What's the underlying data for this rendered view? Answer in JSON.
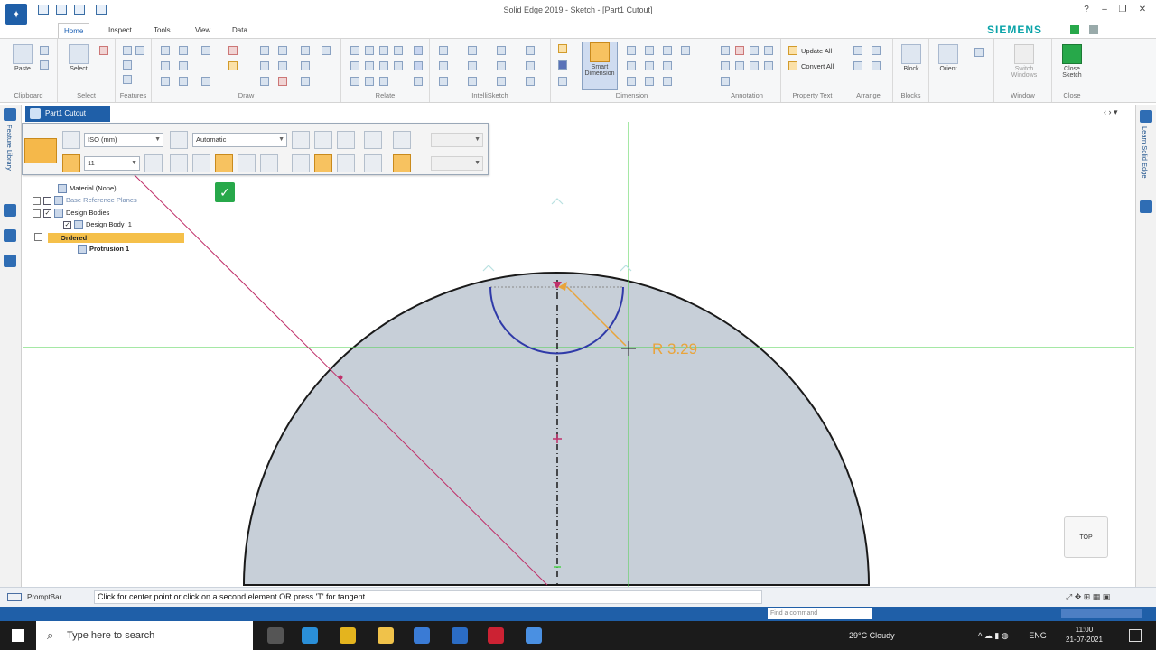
{
  "window": {
    "title": "Solid Edge 2019 - Sketch - [Part1 Cutout]",
    "brand": "SIEMENS"
  },
  "ribbon": {
    "tabs": [
      "Home",
      "Inspect",
      "Tools",
      "View",
      "Data Management"
    ],
    "active_tab": "Home",
    "groups": {
      "clipboard": {
        "label": "Clipboard",
        "paste": "Paste"
      },
      "select": {
        "label": "Select",
        "select": "Select"
      },
      "features": {
        "label": "Features"
      },
      "draw": {
        "label": "Draw"
      },
      "relate": {
        "label": "Relate"
      },
      "intellisketch": {
        "label": "IntelliSketch"
      },
      "dimension": {
        "label": "Dimension",
        "smart_dimension": "Smart Dimension"
      },
      "annotation": {
        "label": "Annotation"
      },
      "property_text": {
        "label": "Property Text",
        "update_all": "Update All",
        "convert_all": "Convert All"
      },
      "arrange": {
        "label": "Arrange"
      },
      "blocks": {
        "label": "Blocks",
        "block": "Block"
      },
      "orient": {
        "label": "Orient"
      },
      "window": {
        "label": "Window",
        "switch_windows": "Switch Windows"
      },
      "close": {
        "label": "Close",
        "close_sketch": "Close Sketch"
      }
    }
  },
  "doc_tab": {
    "label": "Part1 Cutout"
  },
  "left_panel": {
    "label": "Feature Library"
  },
  "right_panel": {
    "label": "Learn Solid Edge"
  },
  "command_bar": {
    "dim_style": "ISO (mm)",
    "orientation": "Automatic",
    "font_size": "11",
    "disabled_1": "",
    "disabled_2": ""
  },
  "tree": {
    "items": [
      {
        "label": "Material (None)",
        "checked": false
      },
      {
        "label": "Base Reference Planes",
        "checked": false
      },
      {
        "label": "Design Bodies",
        "checked": true
      },
      {
        "label": "Design Body_1",
        "checked": true
      }
    ],
    "ordered": "Ordered",
    "protrusion": "Protrusion 1"
  },
  "sketch": {
    "dimension_text": "R 3.29",
    "colors": {
      "body_fill": "#c7cfd8",
      "outline": "#1a1a1a",
      "arc": "#2f3aa8",
      "construction": "#c0306a",
      "axis_green": "#4bd24b",
      "dimension": "#e9a43a"
    }
  },
  "view_cube": {
    "label": "TOP"
  },
  "prompt": {
    "label": "PromptBar",
    "text": "Click for center point or click on a second element OR press 'T' for tangent."
  },
  "status": {
    "find_placeholder": "Find a command"
  },
  "taskbar": {
    "search_placeholder": "Type here to search",
    "weather": "29°C  Cloudy",
    "language": "ENG",
    "time": "11:00",
    "date": "21-07-2021"
  }
}
